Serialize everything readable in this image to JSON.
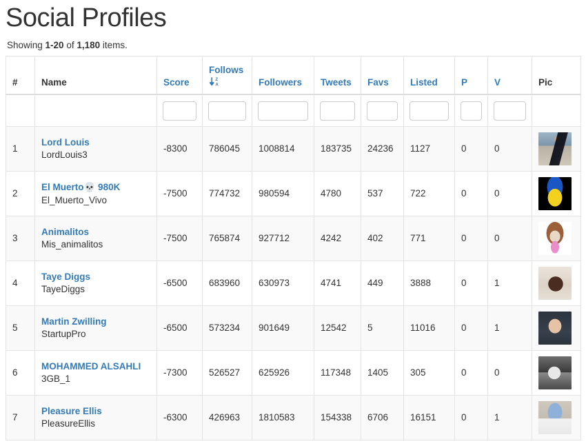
{
  "page": {
    "title": "Social Profiles",
    "summary_prefix": "Showing ",
    "summary_range": "1-20",
    "summary_of": " of ",
    "summary_total": "1,180",
    "summary_suffix": " items."
  },
  "colors": {
    "link": "#337ab7",
    "text": "#333333",
    "border": "#e3e3e3",
    "stripe": "#f9f9f9",
    "input_border": "#cccccc"
  },
  "table": {
    "columns": [
      {
        "key": "num",
        "label": "#",
        "sortable": false,
        "filter": false,
        "sorted": null
      },
      {
        "key": "name",
        "label": "Name",
        "sortable": false,
        "filter": false,
        "sorted": null
      },
      {
        "key": "score",
        "label": "Score",
        "sortable": true,
        "filter": true,
        "sorted": null
      },
      {
        "key": "follows",
        "label": "Follows",
        "sortable": true,
        "filter": true,
        "sorted": "desc",
        "sort_icon": "sort-alpha-desc-icon"
      },
      {
        "key": "followers",
        "label": "Followers",
        "sortable": true,
        "filter": true,
        "sorted": null
      },
      {
        "key": "tweets",
        "label": "Tweets",
        "sortable": true,
        "filter": true,
        "sorted": null
      },
      {
        "key": "favs",
        "label": "Favs",
        "sortable": true,
        "filter": true,
        "sorted": null
      },
      {
        "key": "listed",
        "label": "Listed",
        "sortable": true,
        "filter": true,
        "sorted": null
      },
      {
        "key": "p",
        "label": "P",
        "sortable": true,
        "filter": true,
        "sorted": null
      },
      {
        "key": "v",
        "label": "V",
        "sortable": true,
        "filter": true,
        "sorted": null
      },
      {
        "key": "pic",
        "label": "Pic",
        "sortable": false,
        "filter": false,
        "sorted": null
      }
    ],
    "filters": {
      "score": "",
      "follows": "",
      "followers": "",
      "tweets": "",
      "favs": "",
      "listed": "",
      "p": "",
      "v": ""
    },
    "rows": [
      {
        "num": "1",
        "name": "Lord Louis",
        "handle": "LordLouis3",
        "score": "-8300",
        "follows": "786045",
        "followers": "1008814",
        "tweets": "183735",
        "favs": "24236",
        "listed": "1127",
        "p": "0",
        "v": "0",
        "pic": "avatar-lord-louis"
      },
      {
        "num": "2",
        "name": "El Muerto💀 980K",
        "handle": "El_Muerto_Vivo",
        "score": "-7500",
        "follows": "774732",
        "followers": "980594",
        "tweets": "4780",
        "favs": "537",
        "listed": "722",
        "p": "0",
        "v": "0",
        "pic": "avatar-el-muerto"
      },
      {
        "num": "3",
        "name": "Animalitos",
        "handle": "Mis_animalitos",
        "score": "-7500",
        "follows": "765874",
        "followers": "927712",
        "tweets": "4242",
        "favs": "402",
        "listed": "771",
        "p": "0",
        "v": "0",
        "pic": "avatar-animalitos"
      },
      {
        "num": "4",
        "name": "Taye Diggs",
        "handle": "TayeDiggs",
        "score": "-6500",
        "follows": "683960",
        "followers": "630973",
        "tweets": "4741",
        "favs": "449",
        "listed": "3888",
        "p": "0",
        "v": "1",
        "pic": "avatar-taye-diggs"
      },
      {
        "num": "5",
        "name": "Martin Zwilling",
        "handle": "StartupPro",
        "score": "-6500",
        "follows": "573234",
        "followers": "901649",
        "tweets": "12542",
        "favs": "5",
        "listed": "11016",
        "p": "0",
        "v": "1",
        "pic": "avatar-martin-zwilling"
      },
      {
        "num": "6",
        "name": "MOHAMMED ALSAHLI",
        "handle": "3GB_1",
        "score": "-7300",
        "follows": "526527",
        "followers": "625926",
        "tweets": "117348",
        "favs": "1405",
        "listed": "305",
        "p": "0",
        "v": "0",
        "pic": "avatar-mohammed-alsahli"
      },
      {
        "num": "7",
        "name": "Pleasure Ellis",
        "handle": "PleasureEllis",
        "score": "-6300",
        "follows": "426963",
        "followers": "1810583",
        "tweets": "154338",
        "favs": "6706",
        "listed": "16151",
        "p": "0",
        "v": "1",
        "pic": "avatar-pleasure-ellis"
      }
    ]
  }
}
